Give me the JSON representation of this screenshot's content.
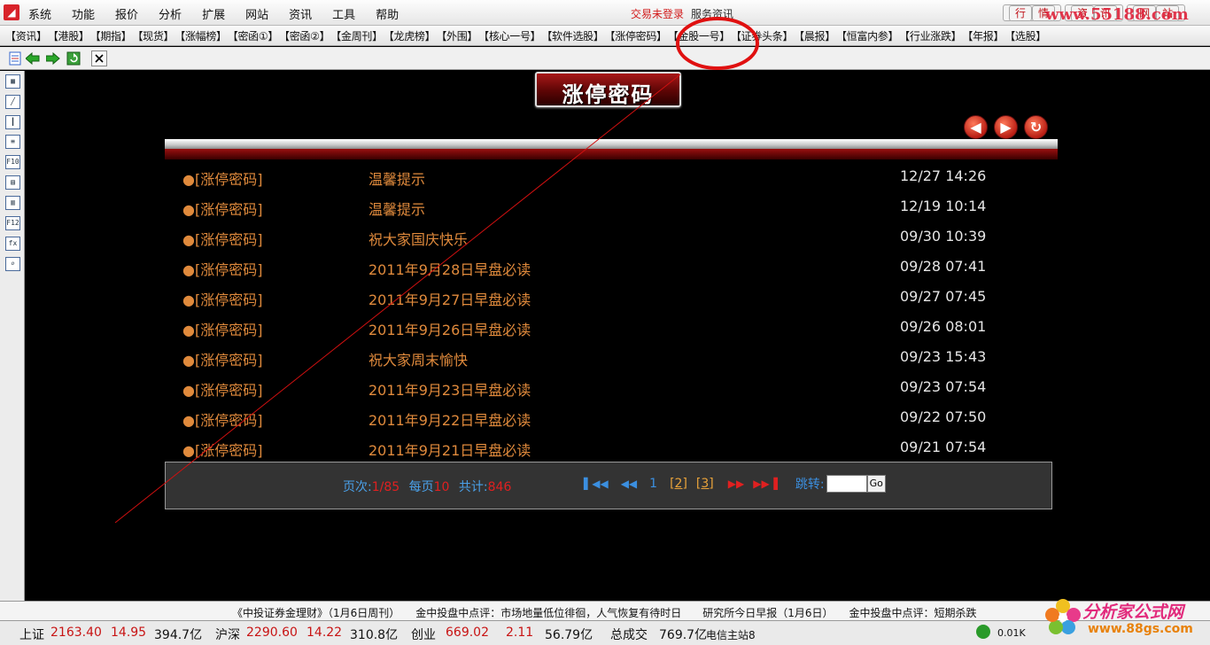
{
  "app": {
    "menu": [
      "系统",
      "功能",
      "报价",
      "分析",
      "扩展",
      "网站",
      "资讯",
      "工具",
      "帮助"
    ],
    "login_status": "交易未登录",
    "login_status2": "服务资讯",
    "window_tabs": [
      "行",
      "情",
      "资",
      "讯",
      "网",
      "站"
    ],
    "watermark_top": "www.55188.com"
  },
  "tabs": [
    "【资讯】",
    "【港股】",
    "【期指】",
    "【现货】",
    "【涨幅榜】",
    "【密函①】",
    "【密函②】",
    "【金周刊】",
    "【龙虎榜】",
    "【外围】",
    "【核心一号】",
    "【软件选股】",
    "【涨停密码】",
    "【金股一号】",
    "【证券头条】",
    "【晨报】",
    "【恒富内参】",
    "【行业涨跌】",
    "【年报】",
    "【选股】"
  ],
  "main": {
    "banner": "涨停密码",
    "nav": {
      "back": "◀",
      "forward": "▶",
      "refresh": "↻"
    },
    "rows": [
      {
        "cat": "●[涨停密码]",
        "title": "温馨提示",
        "time": "12/27 14:26"
      },
      {
        "cat": "●[涨停密码]",
        "title": "温馨提示",
        "time": "12/19 10:14"
      },
      {
        "cat": "●[涨停密码]",
        "title": "祝大家国庆快乐",
        "time": "09/30 10:39"
      },
      {
        "cat": "●[涨停密码]",
        "title": "2011年9月28日早盘必读",
        "time": "09/28 07:41"
      },
      {
        "cat": "●[涨停密码]",
        "title": "2011年9月27日早盘必读",
        "time": "09/27 07:45"
      },
      {
        "cat": "●[涨停密码]",
        "title": "2011年9月26日早盘必读",
        "time": "09/26 08:01"
      },
      {
        "cat": "●[涨停密码]",
        "title": "祝大家周末愉快",
        "time": "09/23 15:43"
      },
      {
        "cat": "●[涨停密码]",
        "title": "2011年9月23日早盘必读",
        "time": "09/23 07:54"
      },
      {
        "cat": "●[涨停密码]",
        "title": "2011年9月22日早盘必读",
        "time": "09/22 07:50"
      },
      {
        "cat": "●[涨停密码]",
        "title": "2011年9月21日早盘必读",
        "time": "09/21 07:54"
      }
    ],
    "pager": {
      "page_label": "页次:",
      "page_value": "1/85",
      "per_label": "每页",
      "per_value": "10",
      "total_label": "共计:",
      "total_value": "846",
      "current": "1",
      "page2": "[2]",
      "page3": "[3]",
      "jump_label": "跳转:",
      "go": "Go"
    }
  },
  "ticker": "《中投证券金理财》（1月6日周刊）　　金中投盘中点评：市场地量低位徘徊，人气恢复有待时日　　研究所今日早报（1月6日）　　金中投盘中点评：短期杀跌",
  "status": {
    "sh_label": "上证",
    "sh_index": "2163.40",
    "sh_change": "14.95",
    "sh_amount": "394.7亿",
    "hs_label": "沪深",
    "hs_index": "2290.60",
    "hs_change": "14.22",
    "hs_amount": "310.8亿",
    "cy_label": "创业",
    "cy_index": "669.02",
    "cy_change": "2.11",
    "cy_amount": "56.79亿",
    "total_label": "总成交",
    "total_value": "769.7亿",
    "server": "电信主站8",
    "speed": "0.01K"
  },
  "watermark_bottom": {
    "line1": "分析家公式网",
    "line2": "www.88gs.com"
  },
  "colors": {
    "accent": "#e08a3c",
    "banner_red": "#a81818",
    "ticker_red": "#c81414"
  }
}
